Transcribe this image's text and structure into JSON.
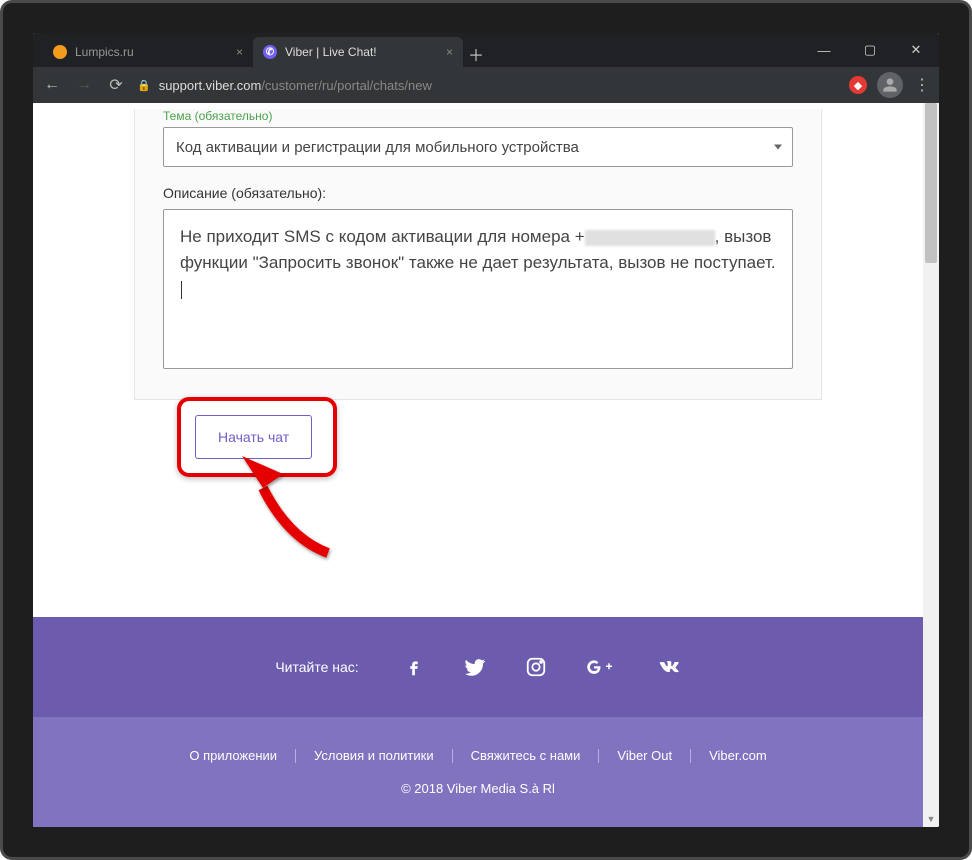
{
  "tabs": {
    "inactive_title": "Lumpics.ru",
    "active_title": "Viber | Live Chat!"
  },
  "url": {
    "host": "support.viber.com",
    "path": "/customer/ru/portal/chats/new"
  },
  "form": {
    "subject_label": "Тема (обязательно)",
    "subject_value": "Код активации и регистрации для мобильного устройства",
    "description_label": "Описание (обязательно):",
    "description_value_part1": "Не приходит SMS с кодом активации для номера +",
    "description_value_part2": ", вызов функции \"Запросить звонок\" также не дает результата, вызов не поступает.",
    "start_chat_button": "Начать чат"
  },
  "footer": {
    "read_us": "Читайте нас:",
    "links": {
      "about": "О приложении",
      "terms": "Условия и политики",
      "contact": "Свяжитесь с нами",
      "viber_out": "Viber Out",
      "viber_com": "Viber.com"
    },
    "copyright": "© 2018 Viber Media S.à Rl"
  }
}
